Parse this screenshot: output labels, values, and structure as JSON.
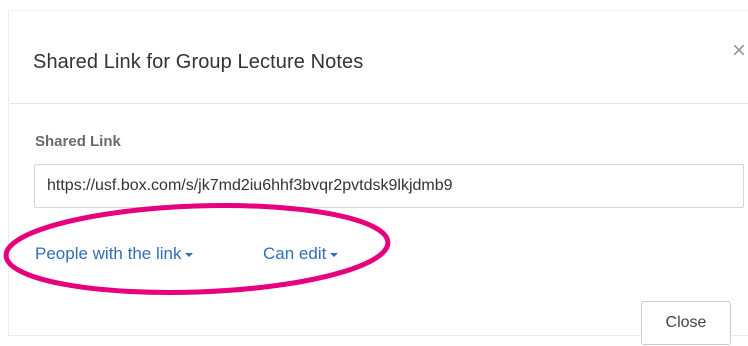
{
  "dialog": {
    "title": "Shared Link for Group Lecture Notes",
    "close_icon": "×",
    "shared_link_label": "Shared Link",
    "shared_link_value": "https://usf.box.com/s/jk7md2iu6hhf3bvqr2pvtdsk9lkjdmb9",
    "access_dropdown_label": "People with the link",
    "permission_dropdown_label": "Can edit",
    "close_button_label": "Close"
  },
  "colors": {
    "link_blue": "#2f6fb7",
    "highlight_magenta": "#e6007e"
  }
}
